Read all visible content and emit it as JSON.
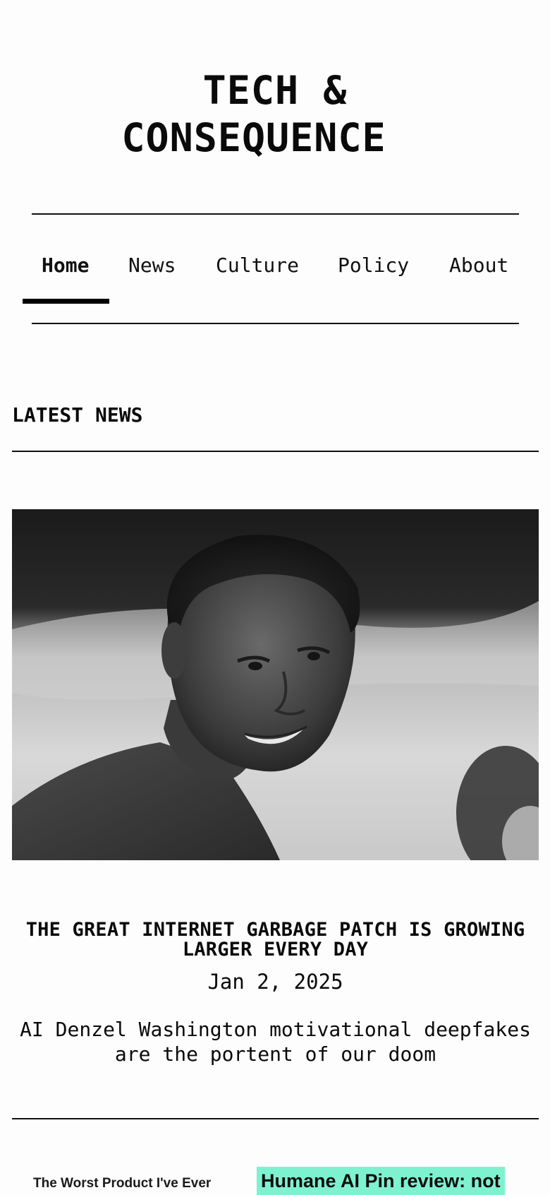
{
  "header": {
    "title_line1": "TECH &",
    "title_line2": "CONSEQUENCE"
  },
  "nav": {
    "items": [
      {
        "label": "Home",
        "active": true
      },
      {
        "label": "News",
        "active": false
      },
      {
        "label": "Culture",
        "active": false
      },
      {
        "label": "Policy",
        "active": false
      },
      {
        "label": "About",
        "active": false
      }
    ]
  },
  "section": {
    "heading": "LATEST NEWS"
  },
  "featured": {
    "title": "THE GREAT INTERNET GARBAGE PATCH IS GROWING LARGER EVERY DAY",
    "date": "Jan 2, 2025",
    "summary": "AI Denzel Washington motivational deepfakes are the portent of our doom"
  },
  "next_cards": [
    {
      "text": "The Worst Product I've Ever"
    },
    {
      "text": "Humane AI Pin review: not",
      "highlight_color": "#7ef2cf"
    }
  ],
  "colors": {
    "text": "#0a0a0a",
    "background": "#fdfdfd",
    "accent_highlight": "#7ef2cf"
  }
}
